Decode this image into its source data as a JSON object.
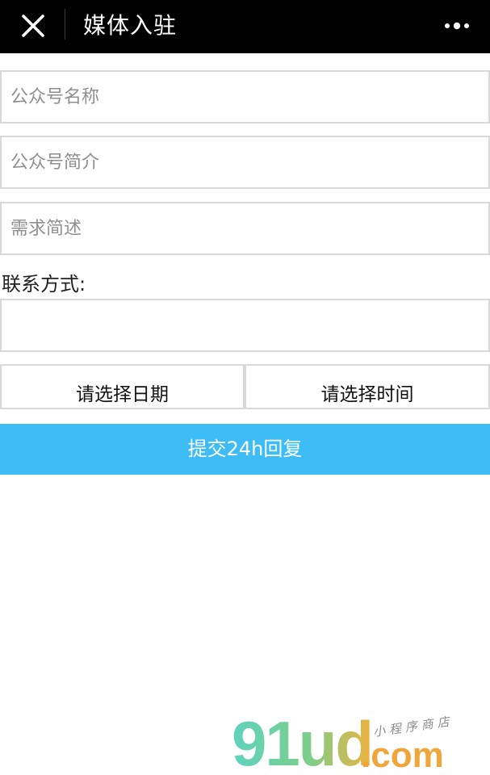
{
  "nav": {
    "title": "媒体入驻",
    "close_icon": "close-icon",
    "more_icon": "more-icon"
  },
  "form": {
    "account_name_placeholder": "公众号名称",
    "account_intro_placeholder": "公众号简介",
    "requirement_placeholder": "需求简述",
    "contact_label": "联系方式:",
    "contact_value": "",
    "date_picker_label": "请选择日期",
    "time_picker_label": "请选择时间",
    "submit_label": "提交24h回复"
  },
  "watermark": {
    "brand": "91ud",
    "suffix": ".com",
    "tagline": "小程序商店"
  },
  "colors": {
    "nav_bg": "#000000",
    "submit_bg": "#3ebcf6",
    "border": "#d9d9d9",
    "placeholder": "#8f8f8f"
  }
}
